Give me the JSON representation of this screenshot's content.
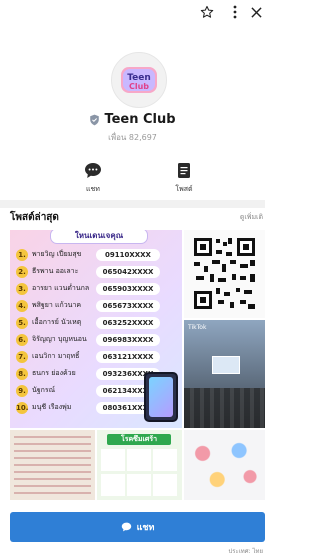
{
  "profile": {
    "name": "Teen Club",
    "followers": "เพื่อน 82,697",
    "logo_text_top": "Teen",
    "logo_text_bottom": "Club"
  },
  "actions": {
    "chat_label": "แชท",
    "posts_label": "โพสต์"
  },
  "posts": {
    "title": "โพสต์ล่าสุด",
    "see_more": "ดูเพิ่มเติ",
    "ranking": {
      "banner": "ใหนเดนเจคุณ",
      "rows": [
        {
          "num": "1.",
          "name": "พายวิญ เปี่ยมสุข",
          "phone": "09110XXXX"
        },
        {
          "num": "2.",
          "name": "ธีรพาน ออเลาะ",
          "phone": "065042XXXX"
        },
        {
          "num": "3.",
          "name": "อารยา แวนด่ำนกล",
          "phone": "065903XXXX"
        },
        {
          "num": "4.",
          "name": "พสิฐยา แก้วนาค",
          "phone": "065673XXXX"
        },
        {
          "num": "5.",
          "name": "เอื้อการย์ นัวเหตุ",
          "phone": "063252XXXX"
        },
        {
          "num": "6.",
          "name": "จิรัญญา บุญหนอน",
          "phone": "096983XXXX"
        },
        {
          "num": "7.",
          "name": "เอนวิกา มาฤทธิ์",
          "phone": "063121XXXX"
        },
        {
          "num": "8.",
          "name": "ธนกร ย่องค้วย",
          "phone": "093236XXXX"
        },
        {
          "num": "9.",
          "name": "นัฐกรณ์",
          "phone": "062134XXXX"
        },
        {
          "num": "10.",
          "name": "มนุชี เรืองพุ่ม",
          "phone": "080361XXXX"
        }
      ]
    },
    "video_badge": "TikTok",
    "depression_title": "โรคซึมเศร้า"
  },
  "chat_button": {
    "label": "แชท"
  },
  "footer": "ประเทศ: ไทย",
  "colors": {
    "accent": "#2f7fd6",
    "background": "#ffffff"
  },
  "icons": [
    "star-icon",
    "more-vertical-icon",
    "close-icon",
    "shield-icon",
    "chat-bubble-icon",
    "document-icon"
  ]
}
